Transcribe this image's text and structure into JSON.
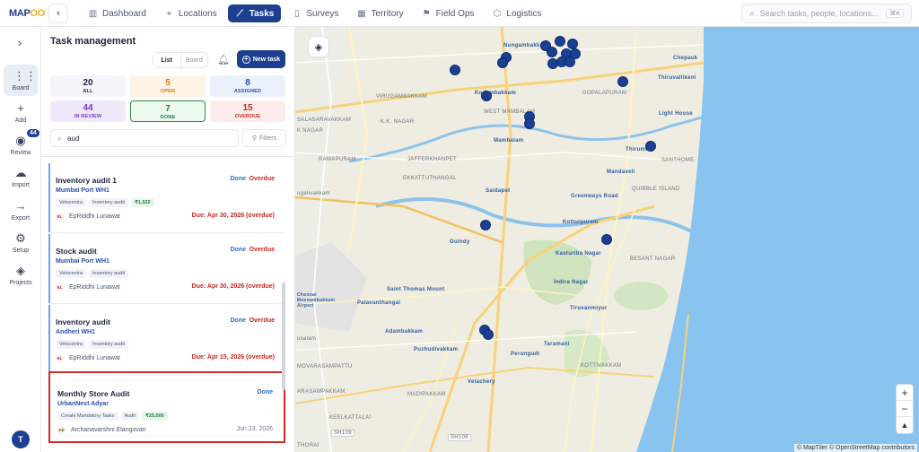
{
  "app": {
    "logo_main": "MAP",
    "logo_accent": "OO"
  },
  "nav": {
    "back": "‹",
    "tabs": [
      {
        "label": "Dashboard",
        "icon": "▥"
      },
      {
        "label": "Locations",
        "icon": "⌖"
      },
      {
        "label": "Tasks",
        "icon": "⟋"
      },
      {
        "label": "Surveys",
        "icon": "▯"
      },
      {
        "label": "Territory",
        "icon": "▦"
      },
      {
        "label": "Field Ops",
        "icon": "⚑"
      },
      {
        "label": "Logistics",
        "icon": "⬡"
      }
    ],
    "active_index": 2,
    "search_placeholder": "Search tasks, people, locations...",
    "search_shortcut": "⌘K"
  },
  "rail": {
    "items": [
      {
        "label": "Board",
        "icon": "⋮⋮"
      },
      {
        "label": "Add",
        "icon": "+"
      },
      {
        "label": "Review",
        "icon": "◉",
        "badge": "44"
      },
      {
        "label": "Import",
        "icon": "☁"
      },
      {
        "label": "Export",
        "icon": "→"
      },
      {
        "label": "Setup",
        "icon": "⚙"
      },
      {
        "label": "Projects",
        "icon": "◈"
      }
    ],
    "avatar": "T"
  },
  "panel": {
    "title": "Task management",
    "view_list": "List",
    "view_board": "Board",
    "new_task": "New task",
    "stats": [
      {
        "count": "20",
        "label": "ALL"
      },
      {
        "count": "5",
        "label": "OPEN"
      },
      {
        "count": "8",
        "label": "ASSIGNED"
      },
      {
        "count": "44",
        "label": "IN REVIEW"
      },
      {
        "count": "7",
        "label": "DONE"
      },
      {
        "count": "15",
        "label": "OVERDUE"
      }
    ],
    "search_value": "aud",
    "filters_label": "Filters"
  },
  "tasks": [
    {
      "title": "Inventory audit 1",
      "location": "Mumbai Port WH1",
      "tags": [
        "Velocentra",
        "Inventory audit"
      ],
      "amount": "₹1,522",
      "assignee_initials": "EL",
      "assignee": "EpRiddhi Lunawat",
      "status": "Done",
      "overdue": "Overdue",
      "due": "Due: Apr 30, 2026 (overdue)"
    },
    {
      "title": "Stock audit",
      "location": "Mumbai Port WH1",
      "tags": [
        "Velocentra",
        "Inventory audit"
      ],
      "amount": "",
      "assignee_initials": "EL",
      "assignee": "EpRiddhi Lunawat",
      "status": "Done",
      "overdue": "Overdue",
      "due": "Due: Apr 30, 2026 (overdue)"
    },
    {
      "title": "Inventory audit",
      "location": "Andheri WH1",
      "tags": [
        "Velocentra",
        "Inventory audit"
      ],
      "amount": "",
      "assignee_initials": "EL",
      "assignee": "EpRiddhi Lunawat",
      "status": "Done",
      "overdue": "Overdue",
      "due": "Due: Apr 15, 2026 (overdue)"
    },
    {
      "title": "Monthly Store Audit",
      "location": "UrbanNest Adyar",
      "tags": [
        "Create Mandatory Tasks",
        "Audit"
      ],
      "amount": "₹25,000",
      "assignee_initials": "AE",
      "assignee": "Archanavarshni Elangovan",
      "status": "Done",
      "overdue": "",
      "due": "Jun 23, 2026"
    }
  ],
  "map": {
    "labels": {
      "nungambakkam": "Nungambakkam",
      "chepauk": "Chepauk",
      "thiruvallikeni": "Thiruvallikeni",
      "virugambakkam": "VIRUGAMBAKKAM",
      "kodambakkam": "Kodambakkam",
      "gopalapuram": "GOPALAPURAM",
      "kknagar": "K.K. NAGAR",
      "westmambalam": "WEST MAMBALAM",
      "lighthouse": "Light House",
      "salasaravakkam": "SALASARAVAKKAM",
      "knagar": "K NAGAR",
      "mambalam": "Mambalam",
      "thirumylai": "Thiruma...",
      "ramapuram": "RAMAPURAM",
      "jafferkhanpet": "JAFFERKHANPET",
      "mandaveli": "Mandaveli",
      "santhome": "SANTHOME",
      "ugalivakkam": "ugalivakkam",
      "ekkattuthangal": "EKKATTUTHANGAL",
      "saidapet": "Saidapet",
      "greenways": "Greenways Road",
      "quibble": "QUIBBLE ISLAND",
      "kotturpuram": "Kotturpuram",
      "guindy": "Guindy",
      "kasturiba": "Kasturiba Nagar",
      "besant": "BESANT NAGAR",
      "chennaiairport": "Chennai Meenambakkam Airport",
      "saintthomas": "Saint Thomas Mount",
      "palavanthangal": "Palavanthangal",
      "indiranagar": "Indira Nagar",
      "thiruvanmiyur": "Tiruvanmiyur",
      "adambakkam": "Adambakkam",
      "usalam": "usalam",
      "taramani": "Taramani",
      "puzhudivakkam": "Puzhudivakkam",
      "perungudi": "Perungudi",
      "movarasampattu": "MOVARASAMPATTU",
      "kottivakkam": "KOTTIVAKKAM",
      "velachery": "Velachery",
      "arasampakkam": "ARASAMPAKKAM",
      "madipakkam": "MADIPAKKAM",
      "keelkattalai": "KEELKATTALAI",
      "sh109a": "SH109",
      "sh109b": "SH109",
      "thorai": "THORAI"
    },
    "zoom_in": "+",
    "zoom_out": "−",
    "compass": "▲",
    "attribution": "© MapTiler © OpenStreetMap contributors"
  }
}
